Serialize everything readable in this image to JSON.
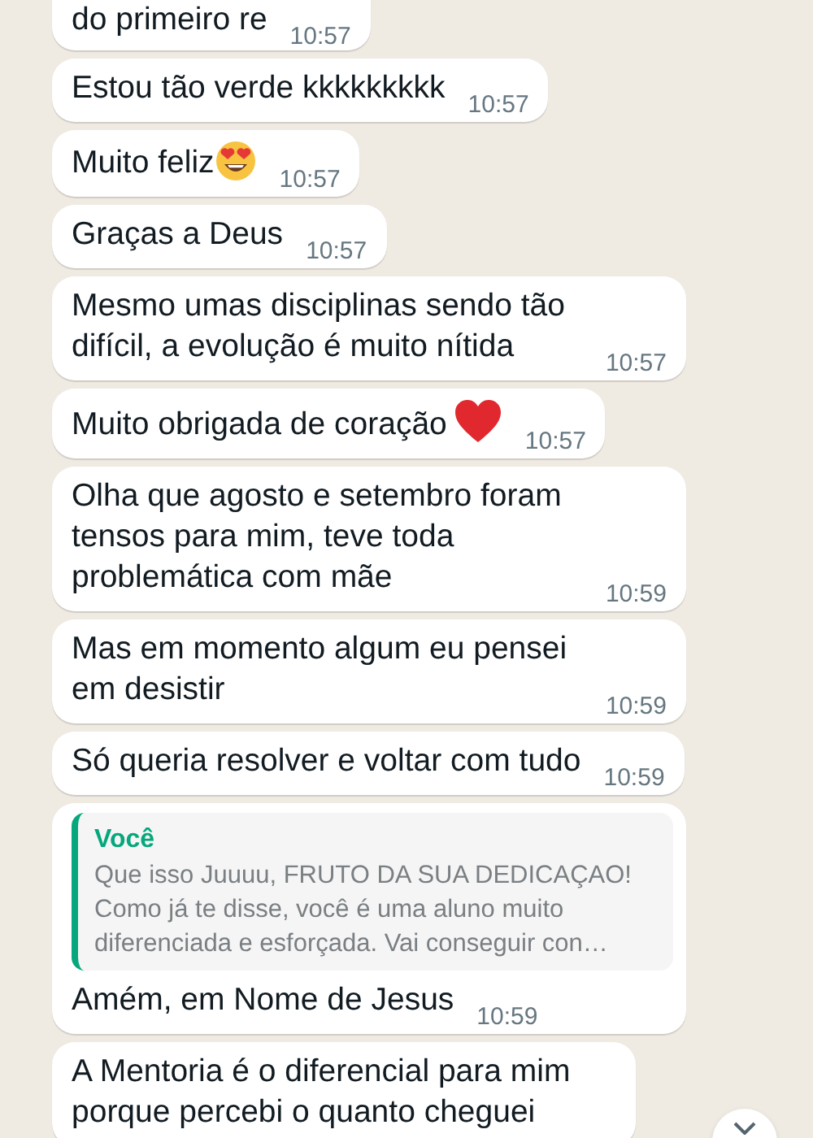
{
  "messages": [
    {
      "kind": "text",
      "text": "do primeiro re",
      "time": "10:57"
    },
    {
      "kind": "text",
      "text": "Estou tão verde kkkkkkkkk",
      "time": "10:57"
    },
    {
      "kind": "heart_eyes",
      "text": "Muito feliz",
      "time": "10:57"
    },
    {
      "kind": "text",
      "text": "Graças a Deus",
      "time": "10:57"
    },
    {
      "kind": "text",
      "text": "Mesmo umas disciplinas sendo tão difícil, a evolução é muito nítida",
      "time": "10:57"
    },
    {
      "kind": "red_heart",
      "text": "Muito obrigada de coração",
      "time": "10:57"
    },
    {
      "kind": "text",
      "text": "Olha que agosto e setembro foram tensos para mim, teve toda problemática com mãe",
      "time": "10:59"
    },
    {
      "kind": "text",
      "text": "Mas em momento algum eu pensei em desistir",
      "time": "10:59"
    },
    {
      "kind": "text",
      "text": "Só queria resolver e voltar com tudo",
      "time": "10:59"
    },
    {
      "kind": "reply",
      "quote_author": "Você",
      "quote_text": "Que isso Juuuu, FRUTO DA SUA DEDICAÇAO! Como já te disse, você é uma aluno muito diferenciada e esforçada. Vai conseguir con…",
      "text": "Amém, em Nome de Jesus",
      "time": "10:59"
    },
    {
      "kind": "text",
      "text": "A Mentoria é o diferencial para mim porque percebi o quanto cheguei"
    }
  ],
  "scroll_down_button": true
}
